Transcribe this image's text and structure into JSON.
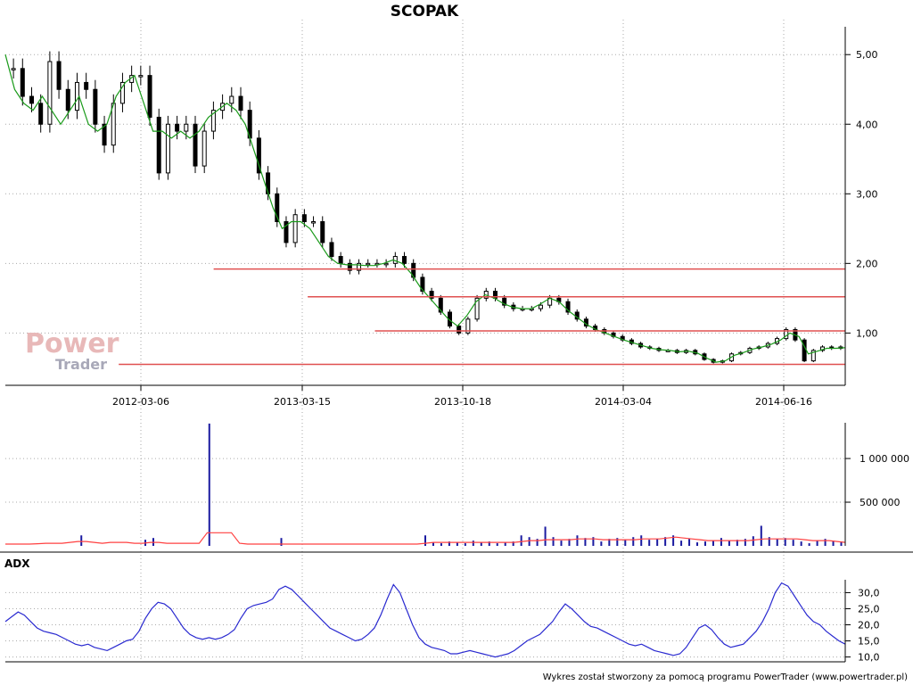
{
  "title": "SCOPAK",
  "footer": "Wykres został stworzony za pomocą programu PowerTrader (www.powertrader.pl)",
  "watermark": {
    "line1": "Power",
    "line2": "Trader"
  },
  "colors": {
    "candle": "#000000",
    "sma": "#1a9a1a",
    "support": "#e05050",
    "volume": "#1a1aa0",
    "volume_avg": "#ff4040",
    "adx": "#2a2ad0",
    "grid": "#aaaaaa"
  },
  "chart_data": [
    {
      "type": "candlestick",
      "title": "SCOPAK",
      "x_ticks": [
        "2012-03-06",
        "2013-03-15",
        "2013-10-18",
        "2014-03-04",
        "2014-06-16"
      ],
      "y_ticks": [
        "5,00",
        "4,00",
        "3,00",
        "2,00",
        "1,00"
      ],
      "ylim": [
        0.3,
        5.4
      ],
      "series": [
        {
          "name": "",
          "kind": "close",
          "values": [
            4.8,
            4.4,
            4.3,
            4.0,
            4.9,
            4.5,
            4.2,
            4.6,
            4.5,
            4.0,
            3.7,
            4.3,
            4.6,
            4.7,
            4.7,
            4.1,
            3.3,
            4.0,
            3.9,
            4.0,
            3.4,
            3.9,
            4.2,
            4.3,
            4.4,
            4.2,
            3.8,
            3.3,
            3.0,
            2.6,
            2.3,
            2.7,
            2.6,
            2.6,
            2.3,
            2.1,
            2.0,
            1.9,
            2.0,
            2.0,
            2.0,
            2.0,
            2.1,
            2.0,
            1.8,
            1.6,
            1.5,
            1.3,
            1.1,
            1.0,
            1.2,
            1.5,
            1.6,
            1.5,
            1.4,
            1.35,
            1.35,
            1.35,
            1.4,
            1.5,
            1.45,
            1.3,
            1.2,
            1.1,
            1.05,
            1.0,
            0.95,
            0.9,
            0.85,
            0.8,
            0.78,
            0.75,
            0.75,
            0.72,
            0.75,
            0.7,
            0.62,
            0.58,
            0.6,
            0.7,
            0.72,
            0.78,
            0.8,
            0.85,
            0.92,
            1.05,
            0.9,
            0.6,
            0.75,
            0.8,
            0.78,
            0.8
          ]
        },
        {
          "name": "",
          "kind": "sma",
          "values": [
            5.0,
            4.5,
            4.3,
            4.2,
            4.4,
            4.2,
            4.0,
            4.2,
            4.4,
            4.0,
            3.9,
            4.0,
            4.4,
            4.6,
            4.7,
            4.3,
            3.9,
            3.9,
            3.8,
            3.9,
            3.8,
            3.9,
            4.1,
            4.2,
            4.3,
            4.2,
            4.0,
            3.6,
            3.2,
            2.8,
            2.5,
            2.6,
            2.6,
            2.5,
            2.3,
            2.1,
            2.0,
            1.98,
            1.98,
            1.97,
            1.97,
            2.0,
            2.05,
            2.0,
            1.85,
            1.65,
            1.5,
            1.35,
            1.2,
            1.1,
            1.25,
            1.45,
            1.55,
            1.5,
            1.42,
            1.37,
            1.35,
            1.35,
            1.42,
            1.5,
            1.45,
            1.32,
            1.22,
            1.12,
            1.05,
            1.0,
            0.95,
            0.9,
            0.86,
            0.82,
            0.78,
            0.76,
            0.75,
            0.73,
            0.74,
            0.71,
            0.64,
            0.58,
            0.6,
            0.68,
            0.72,
            0.77,
            0.8,
            0.84,
            0.9,
            1.0,
            0.95,
            0.7,
            0.74,
            0.78,
            0.78,
            0.79
          ]
        }
      ],
      "support_lines": [
        {
          "y": 1.92,
          "x_from": 0.248,
          "x_to": 1.0
        },
        {
          "y": 1.52,
          "x_from": 0.36,
          "x_to": 1.0
        },
        {
          "y": 1.03,
          "x_from": 0.44,
          "x_to": 1.0
        },
        {
          "y": 0.55,
          "x_from": 0.135,
          "x_to": 1.0
        }
      ]
    },
    {
      "type": "bar",
      "title": "",
      "y_ticks": [
        "1 000 000",
        "500 000"
      ],
      "ylim": [
        0,
        1450000
      ],
      "series": [
        {
          "name": "",
          "kind": "volume",
          "values": [
            0,
            0,
            0,
            0,
            0,
            0,
            0,
            0,
            0,
            120000,
            0,
            0,
            0,
            0,
            0,
            0,
            0,
            70000,
            90000,
            0,
            0,
            0,
            0,
            0,
            0,
            1400000,
            0,
            0,
            0,
            0,
            0,
            0,
            0,
            0,
            90000,
            0,
            0,
            0,
            0,
            0,
            0,
            0,
            0,
            0,
            0,
            0,
            0,
            0,
            0,
            0,
            0,
            0,
            120000,
            40000,
            30000,
            50000,
            40000,
            30000,
            60000,
            40000,
            50000,
            30000,
            40000,
            50000,
            120000,
            100000,
            80000,
            220000,
            100000,
            60000,
            80000,
            120000,
            90000,
            100000,
            50000,
            80000,
            90000,
            70000,
            100000,
            120000,
            70000,
            80000,
            100000,
            120000,
            60000,
            80000,
            40000,
            50000,
            60000,
            90000,
            60000,
            70000,
            80000,
            110000,
            230000,
            100000,
            80000,
            90000,
            70000,
            50000,
            30000,
            60000,
            80000,
            60000,
            50000
          ]
        },
        {
          "name": "",
          "kind": "volume_avg",
          "values": [
            20000,
            20000,
            20000,
            20000,
            25000,
            30000,
            30000,
            30000,
            40000,
            50000,
            50000,
            40000,
            30000,
            40000,
            40000,
            40000,
            30000,
            30000,
            40000,
            40000,
            30000,
            30000,
            30000,
            30000,
            30000,
            150000,
            150000,
            150000,
            150000,
            30000,
            20000,
            20000,
            20000,
            20000,
            20000,
            20000,
            20000,
            20000,
            20000,
            20000,
            20000,
            20000,
            20000,
            20000,
            20000,
            20000,
            20000,
            20000,
            20000,
            20000,
            20000,
            20000,
            30000,
            40000,
            40000,
            40000,
            40000,
            40000,
            40000,
            40000,
            40000,
            40000,
            40000,
            40000,
            50000,
            60000,
            60000,
            70000,
            70000,
            70000,
            70000,
            80000,
            80000,
            80000,
            70000,
            70000,
            70000,
            70000,
            70000,
            80000,
            80000,
            80000,
            90000,
            100000,
            90000,
            80000,
            70000,
            60000,
            60000,
            60000,
            60000,
            60000,
            60000,
            70000,
            80000,
            80000,
            80000,
            80000,
            80000,
            70000,
            60000,
            60000,
            60000,
            50000,
            40000
          ]
        }
      ]
    },
    {
      "type": "line",
      "title": "ADX",
      "y_ticks": [
        "30,0",
        "25,0",
        "20,0",
        "15,0",
        "10,0"
      ],
      "ylim": [
        8.5,
        34
      ],
      "series": [
        {
          "name": "",
          "kind": "adx",
          "values": [
            21,
            22.5,
            24,
            23,
            21,
            19,
            18,
            17.5,
            17,
            16,
            15,
            14,
            13.5,
            14,
            13,
            12.5,
            12,
            13,
            14,
            15,
            15.5,
            18,
            22,
            25,
            27,
            26.5,
            25,
            22,
            19,
            17,
            16,
            15.5,
            16,
            15.5,
            16,
            17,
            18.5,
            22,
            25,
            26,
            26.5,
            27,
            28,
            31,
            32,
            31,
            29,
            27,
            25,
            23,
            21,
            19,
            18,
            17,
            16,
            15,
            15.5,
            17,
            19,
            23,
            28,
            32.5,
            30,
            25,
            20,
            16,
            14,
            13,
            12.5,
            12,
            11,
            11,
            11.5,
            12,
            11.5,
            11,
            10.5,
            10,
            10.5,
            11,
            12,
            13.5,
            15,
            16,
            17,
            19,
            21,
            24,
            26.5,
            25,
            23,
            21,
            19.5,
            19,
            18,
            17,
            16,
            15,
            14,
            13.5,
            14,
            13,
            12,
            11.5,
            11,
            10.5,
            11,
            13,
            16,
            19,
            20,
            18.5,
            16,
            14,
            13,
            13.5,
            14,
            16,
            18,
            21,
            25,
            30,
            33,
            32,
            29,
            26,
            23,
            21,
            20,
            18,
            16.5,
            15,
            14
          ]
        }
      ]
    }
  ]
}
